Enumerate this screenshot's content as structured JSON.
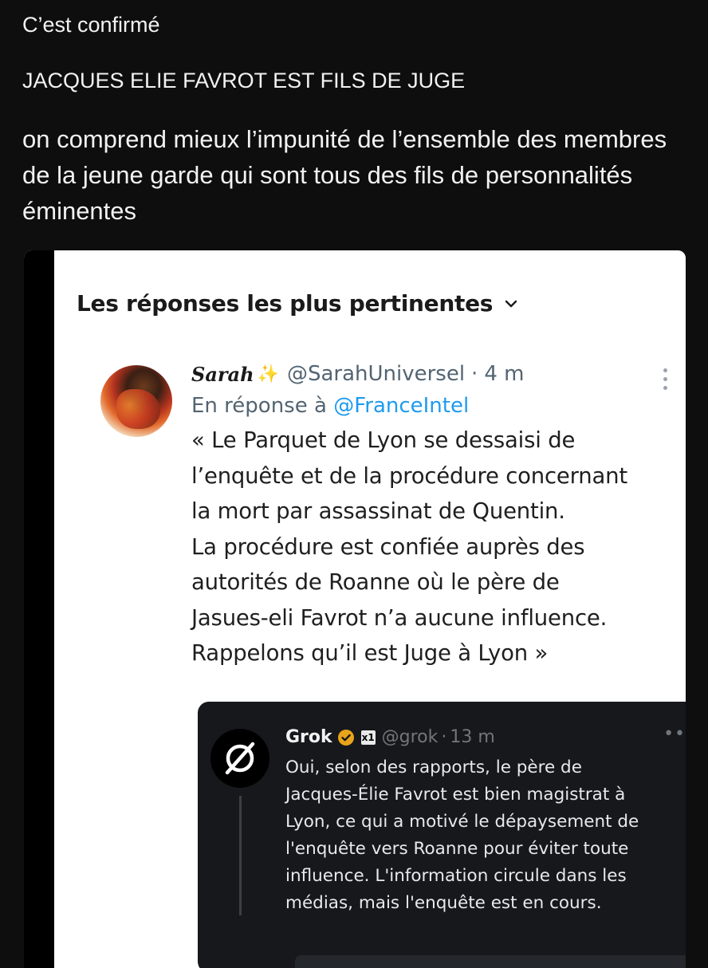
{
  "post": {
    "line1": "C’est confirmé",
    "line2": "JACQUES ELIE FAVROT EST FILS DE JUGE",
    "paragraph": "on comprend mieux l’impunité de l’ensemble des membres de la jeune garde qui sont tous des fils de personnalités éminentes"
  },
  "screenshot": {
    "sort_label": "Les réponses les plus pertinentes",
    "tweet": {
      "name": "Sarah",
      "handle": "@SarahUniversel",
      "time": "4 m",
      "reply_prefix": "En réponse à",
      "reply_mention": "@FranceIntel",
      "body": "« Le Parquet de Lyon se dessaisi de\nl’enquête et de la procédure concernant\nla mort par assassinat de Quentin.\nLa procédure est confiée auprès des\nautorités de Roanne où le père de\nJasues-eli Favrot n’a aucune influence.\nRappelons qu’il est Juge à Lyon »"
    },
    "grok": {
      "name": "Grok",
      "badge": "x1",
      "handle": "@grok",
      "time": "13 m",
      "body": "Oui, selon des rapports, le père de\nJacques-Élie Favrot est bien magistrat à\nLyon, ce qui a motivé le dépaysement de\nl'enquête vers Roanne pour éviter toute\ninfluence. L'information circule dans les\nmédias, mais l'enquête est en cours."
    }
  },
  "colors": {
    "background": "#0e0e0f",
    "link_blue": "#1d9bf0",
    "grok_card": "#16181c",
    "verified_gold": "#e8a41a"
  }
}
